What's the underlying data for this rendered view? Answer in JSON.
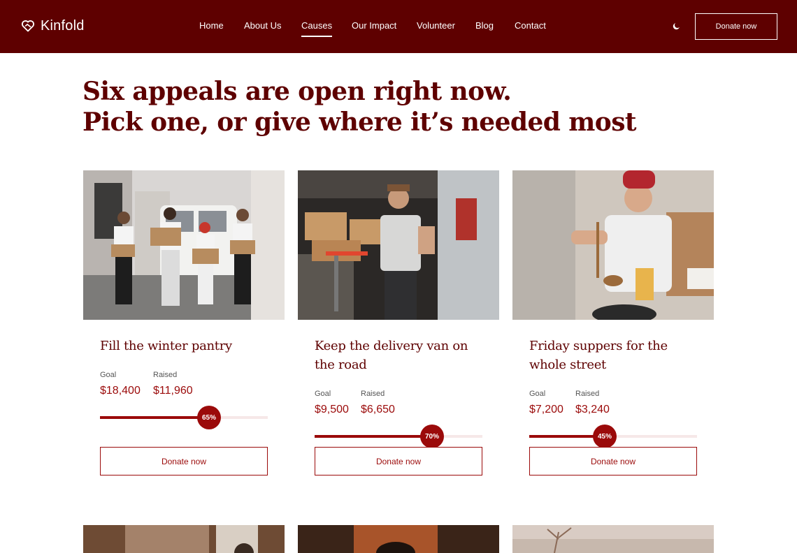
{
  "brand": {
    "name": "Kinfold",
    "logo_icon": "heart-handshake-icon"
  },
  "nav": {
    "items": [
      {
        "label": "Home",
        "active": false
      },
      {
        "label": "About Us",
        "active": false
      },
      {
        "label": "Causes",
        "active": true
      },
      {
        "label": "Our Impact",
        "active": false
      },
      {
        "label": "Volunteer",
        "active": false
      },
      {
        "label": "Blog",
        "active": false
      },
      {
        "label": "Contact",
        "active": false
      }
    ],
    "theme_toggle_icon": "moon-icon",
    "donate_label": "Donate now"
  },
  "hero": {
    "line1": "Six appeals are open right now.",
    "line2": "Pick one, or give where it’s needed most"
  },
  "labels": {
    "goal": "Goal",
    "raised": "Raised"
  },
  "causes": [
    {
      "title": "Fill the winter pantry",
      "goal": "$18,400",
      "raised": "$11,960",
      "progress": 0.65,
      "progress_label": "65%",
      "donate_label": "Donate now"
    },
    {
      "title": "Keep the delivery van on the road",
      "goal": "$9,500",
      "raised": "$6,650",
      "progress": 0.7,
      "progress_label": "70%",
      "donate_label": "Donate now"
    },
    {
      "title": "Friday suppers for the whole street",
      "goal": "$7,200",
      "raised": "$3,240",
      "progress": 0.45,
      "progress_label": "45%",
      "donate_label": "Donate now"
    }
  ],
  "colors": {
    "brand": "#5e0000",
    "accent": "#9b0a0a",
    "track": "#f6e8e8"
  }
}
